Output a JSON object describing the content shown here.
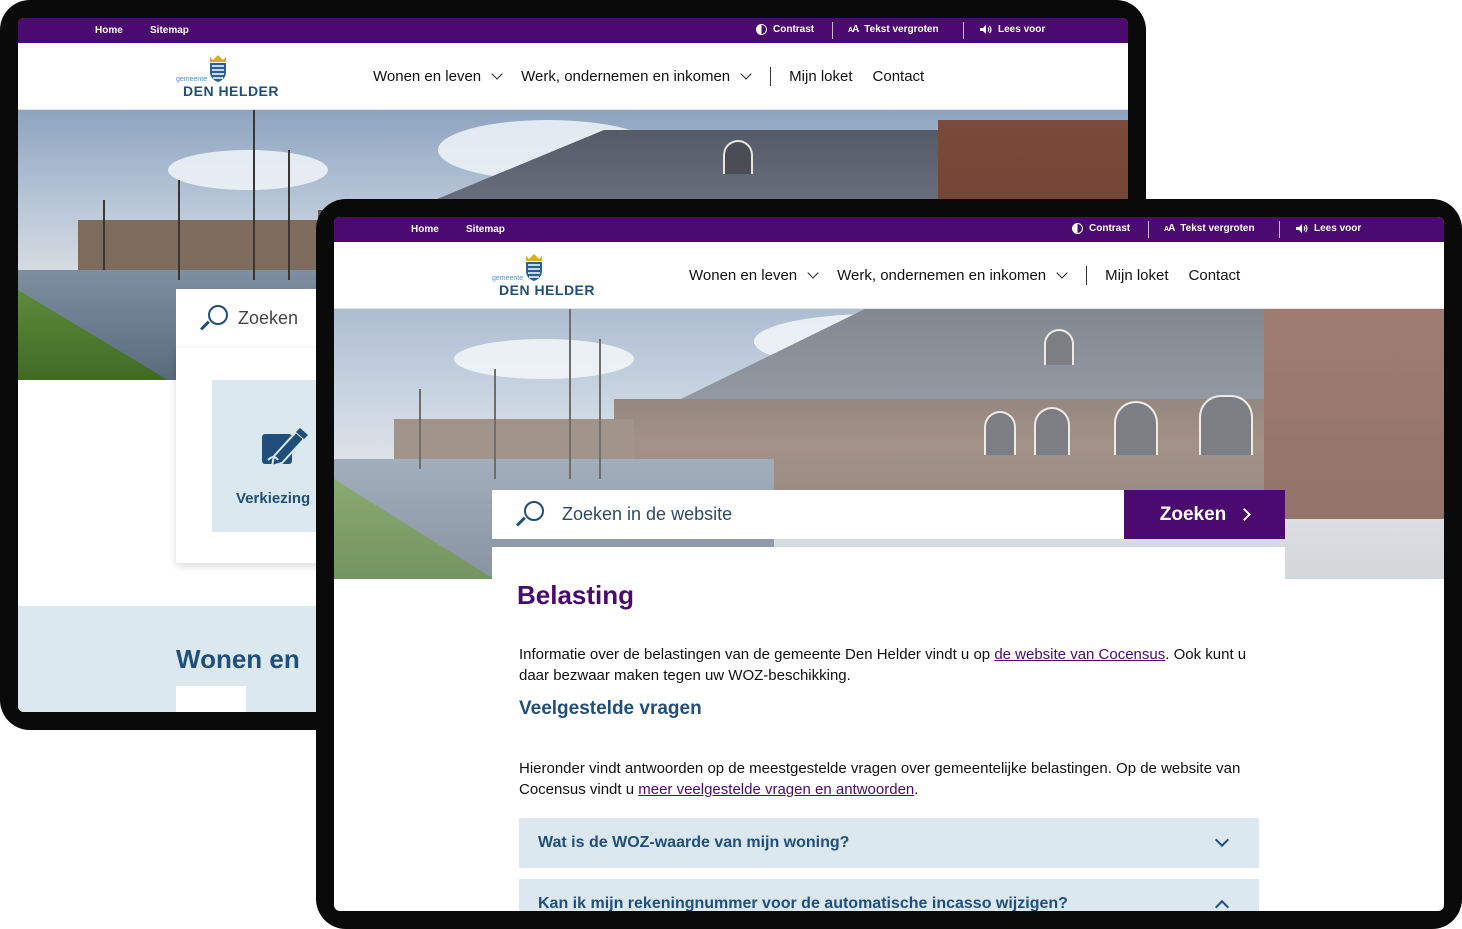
{
  "utility_bar": {
    "home": "Home",
    "sitemap": "Sitemap",
    "contrast": "Contrast",
    "text_size_glyph": "A",
    "text_size_glyph_small": "A",
    "text_size": "Tekst vergroten",
    "read_aloud": "Lees voor"
  },
  "logo": {
    "prefix": "gemeente",
    "name": "DEN HELDER"
  },
  "nav": {
    "items": [
      {
        "label": "Wonen en leven"
      },
      {
        "label": "Werk, ondernemen en inkomen"
      },
      {
        "label": "Mijn loket"
      },
      {
        "label": "Contact"
      }
    ]
  },
  "back_page": {
    "search_label": "Zoeken",
    "tile_label": "Verkiezing",
    "section_heading": "Wonen en"
  },
  "front_page": {
    "search": {
      "placeholder": "Zoeken in de website",
      "button": "Zoeken"
    },
    "title": "Belasting",
    "intro": {
      "before": "Informatie over de belastingen van de gemeente Den Helder vindt u op ",
      "link": "de website van Cocensus",
      "after": ". Ook kunt u daar bezwaar maken tegen uw WOZ-beschikking."
    },
    "faq_heading": "Veelgestelde vragen",
    "faq_intro": {
      "before": "Hieronder vindt antwoorden op de meestgestelde vragen over gemeentelijke belastingen. Op de website van Cocensus vindt u ",
      "link": "meer veelgestelde vragen en antwoorden",
      "after": "."
    },
    "accordion": [
      {
        "question": "Wat is de WOZ-waarde van mijn woning?",
        "expanded": false
      },
      {
        "question": "Kan ik mijn rekeningnummer voor de automatische incasso wijzigen?",
        "expanded": true
      }
    ]
  },
  "colors": {
    "brand_purple": "#4b0a70",
    "brand_blue": "#1f4f7a",
    "light_blue_panel": "#dce8f0"
  }
}
